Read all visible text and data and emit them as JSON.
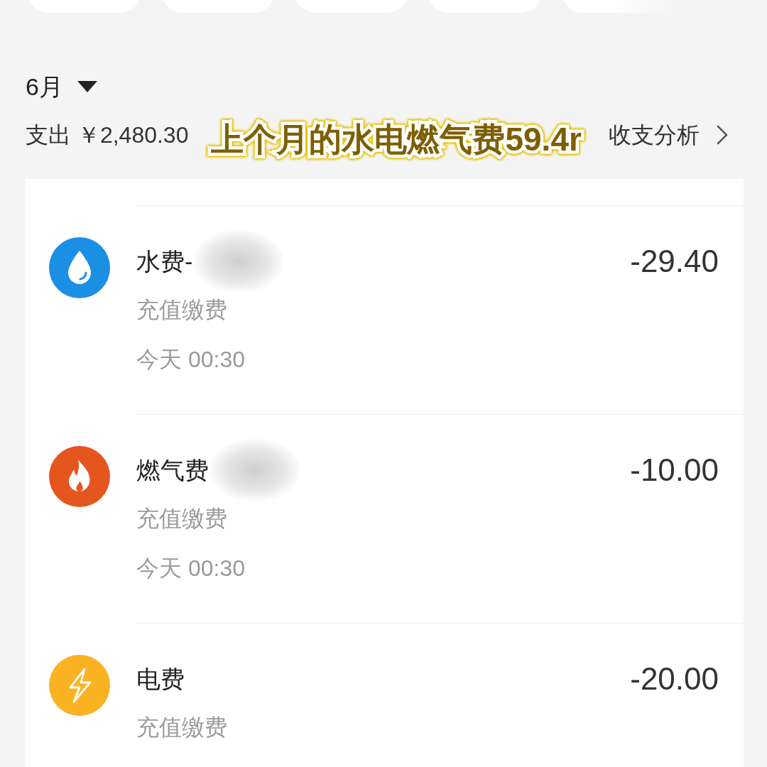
{
  "month_picker": {
    "label": "6月"
  },
  "summary": {
    "expense": "支出 ￥2,480.30",
    "analysis_link": "收支分析"
  },
  "sticker": {
    "text": "上个月的水电燃气费59.4r"
  },
  "transactions": [
    {
      "kind": "water",
      "title": "水费-",
      "redacted": true,
      "category": "充值缴费",
      "time": "今天 00:30",
      "amount": "-29.40"
    },
    {
      "kind": "gas",
      "title": "燃气费",
      "redacted": true,
      "category": "充值缴费",
      "time": "今天 00:30",
      "amount": "-10.00"
    },
    {
      "kind": "electricity",
      "title": "电费",
      "redacted": false,
      "category": "充值缴费",
      "amount": "-20.00"
    }
  ]
}
